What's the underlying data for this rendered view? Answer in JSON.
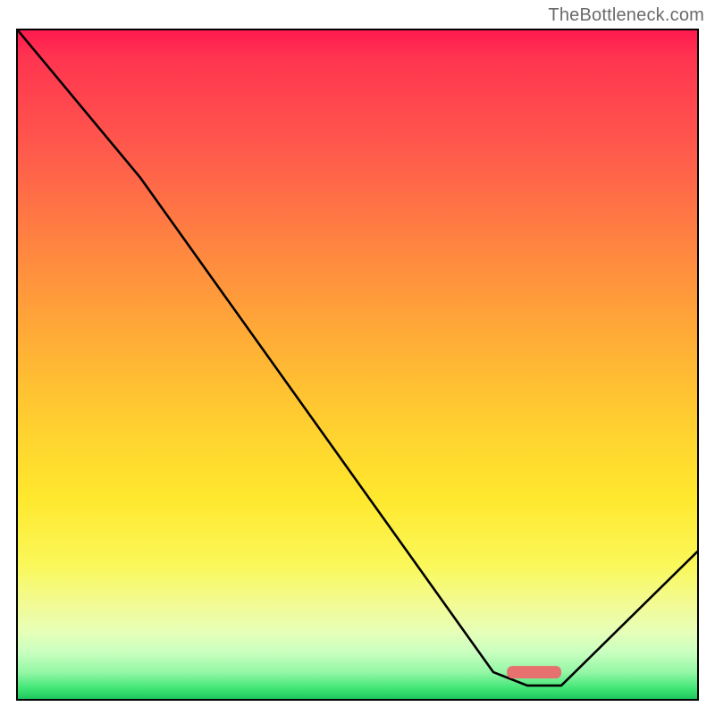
{
  "watermark": "TheBottleneck.com",
  "chart_data": {
    "type": "line",
    "title": "",
    "xlabel": "",
    "ylabel": "",
    "xlim": [
      0,
      100
    ],
    "ylim": [
      0,
      100
    ],
    "series": [
      {
        "name": "curve",
        "x": [
          0,
          18,
          70,
          75,
          80,
          100
        ],
        "values": [
          100,
          78,
          4,
          2,
          2,
          22
        ]
      }
    ],
    "marker": {
      "x_center": 76,
      "y": 4,
      "width": 8
    },
    "gradient_stops": [
      {
        "pos": 0,
        "color": "#ff1a4f"
      },
      {
        "pos": 18,
        "color": "#ff5a4c"
      },
      {
        "pos": 48,
        "color": "#ffb235"
      },
      {
        "pos": 70,
        "color": "#ffe82e"
      },
      {
        "pos": 90,
        "color": "#e6ffb8"
      },
      {
        "pos": 100,
        "color": "#1fc65e"
      }
    ]
  }
}
